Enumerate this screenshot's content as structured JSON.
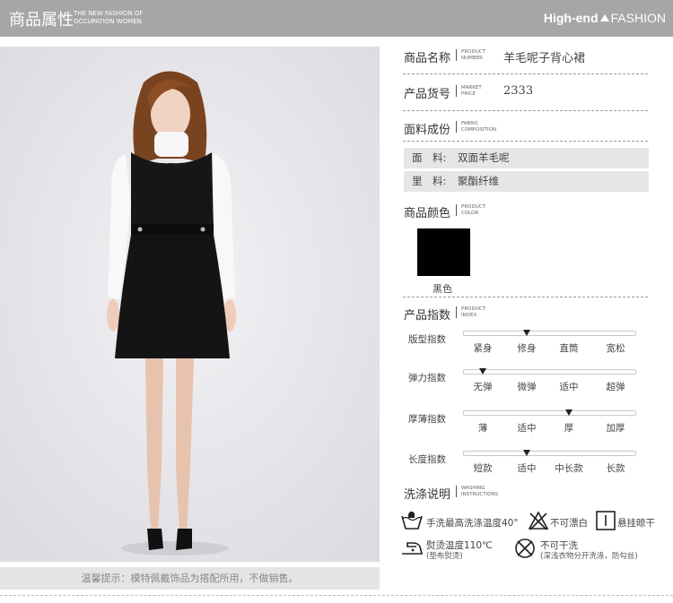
{
  "header": {
    "title": "商品属性",
    "subtitle_line1": "THE NEW FASHION OF",
    "subtitle_line2": "OCCUPATION WOMEN",
    "brand_bold": "High-end",
    "brand_light": "FASHION"
  },
  "caption": "温馨提示：模特佩戴饰品为搭配所用，不做销售。",
  "fields": {
    "name": {
      "label": "商品名称",
      "en1": "PRODUCT",
      "en2": "NUMBER",
      "value": "羊毛呢子背心裙"
    },
    "number": {
      "label": "产品货号",
      "en1": "MARKET",
      "en2": "PRICE",
      "value": "2333"
    },
    "fabric": {
      "label": "面料成份",
      "en1": "FABRIC",
      "en2": "COMPOSITION"
    },
    "color": {
      "label": "商品颜色",
      "en1": "PRODUCT",
      "en2": "COLOR"
    },
    "index": {
      "label": "产品指数",
      "en1": "PRODUCT",
      "en2": "INDEX"
    },
    "wash": {
      "label": "洗涤说明",
      "en1": "WASHING",
      "en2": "INSTRUCTIONS"
    }
  },
  "fabric_rows": [
    {
      "key": "面　料:",
      "value": "双面羊毛呢"
    },
    {
      "key": "里　料:",
      "value": "聚酯纤维"
    }
  ],
  "colors": [
    {
      "name": "黑色",
      "hex": "#000000"
    }
  ],
  "indices": [
    {
      "label": "版型指数",
      "options": [
        "紧身",
        "修身",
        "直筒",
        "宽松"
      ],
      "selected": 1
    },
    {
      "label": "弹力指数",
      "options": [
        "无弹",
        "微弹",
        "适中",
        "超弹"
      ],
      "selected": 0
    },
    {
      "label": "厚薄指数",
      "options": [
        "薄",
        "适中",
        "厚",
        "加厚"
      ],
      "selected": 2
    },
    {
      "label": "长度指数",
      "options": [
        "短款",
        "适中",
        "中长款",
        "长款"
      ],
      "selected": 1
    }
  ],
  "wash": {
    "hand_wash": "手洗最高洗涤温度40°",
    "no_bleach": "不可漂白",
    "hang_dry": "悬挂晾干",
    "iron": "熨烫温度110℃",
    "iron_note": "(垫布熨烫)",
    "no_dry": "不可干洗",
    "no_dry_note": "(深浅衣物分开洗涤，防勾丝)"
  }
}
